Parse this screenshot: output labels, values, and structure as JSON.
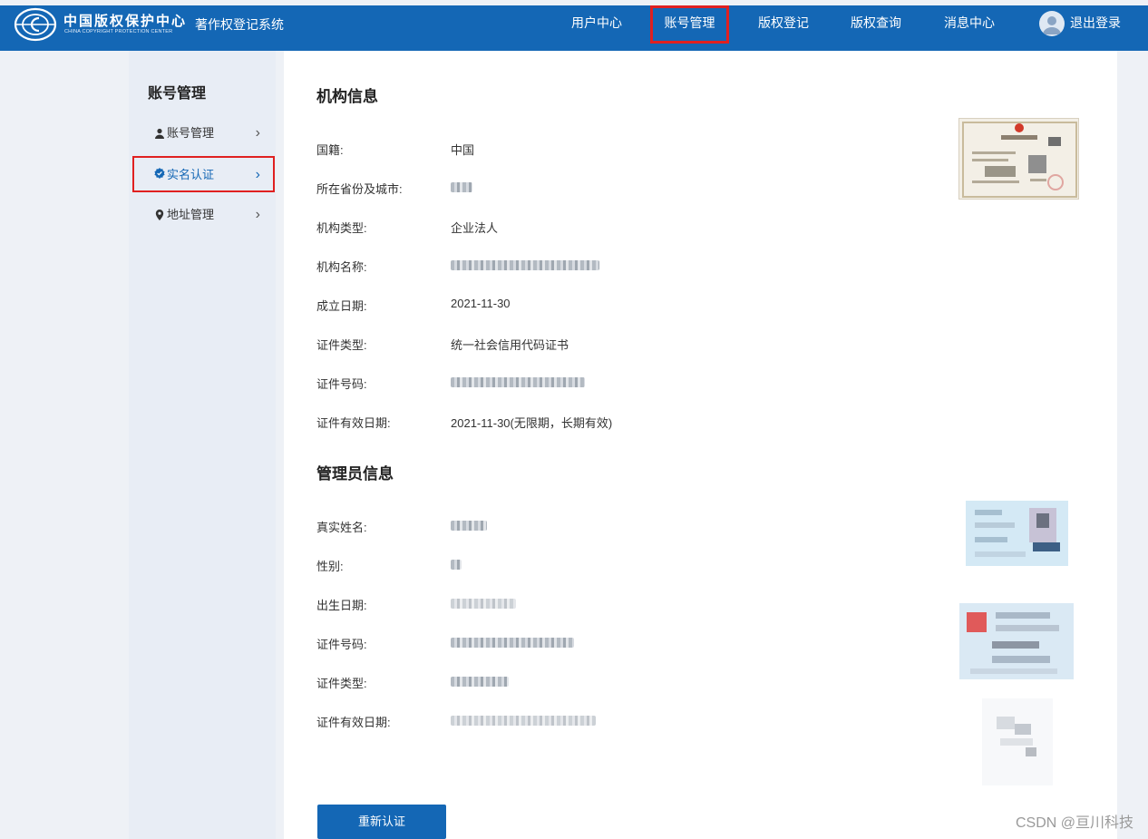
{
  "header": {
    "logo_cn": "中国版权保护中心",
    "logo_en": "CHINA COPYRIGHT PROTECTION CENTER",
    "system_title": "著作权登记系统",
    "nav": [
      "用户中心",
      "账号管理",
      "版权登记",
      "版权查询",
      "消息中心"
    ],
    "active_nav": "账号管理",
    "logout": "退出登录"
  },
  "sidebar": {
    "title": "账号管理",
    "items": [
      {
        "label": "账号管理",
        "icon": "user-icon"
      },
      {
        "label": "实名认证",
        "icon": "verified-badge-icon"
      },
      {
        "label": "地址管理",
        "icon": "location-pin-icon"
      }
    ],
    "active_item": "实名认证"
  },
  "org": {
    "title": "机构信息",
    "rows": [
      {
        "label": "国籍:",
        "value": "中国"
      },
      {
        "label": "所在省份及城市:",
        "value": ""
      },
      {
        "label": "机构类型:",
        "value": "企业法人"
      },
      {
        "label": "机构名称:",
        "value": ""
      },
      {
        "label": "成立日期:",
        "value": "2021-11-30"
      },
      {
        "label": "证件类型:",
        "value": "统一社会信用代码证书"
      },
      {
        "label": "证件号码:",
        "value": ""
      },
      {
        "label": "证件有效日期:",
        "value": "2021-11-30(无限期，长期有效)"
      }
    ]
  },
  "admin": {
    "title": "管理员信息",
    "rows": [
      {
        "label": "真实姓名:",
        "value": ""
      },
      {
        "label": "性别:",
        "value": ""
      },
      {
        "label": "出生日期:",
        "value": ""
      },
      {
        "label": "证件号码:",
        "value": ""
      },
      {
        "label": "证件类型:",
        "value": ""
      },
      {
        "label": "证件有效日期:",
        "value": ""
      }
    ]
  },
  "actions": {
    "recertify": "重新认证"
  },
  "watermark": "CSDN @亘川科技",
  "colors": {
    "brand": "#1467b5",
    "highlight": "#e02020",
    "sidebar_bg": "#e8edf5",
    "page_bg": "#eef1f6"
  }
}
